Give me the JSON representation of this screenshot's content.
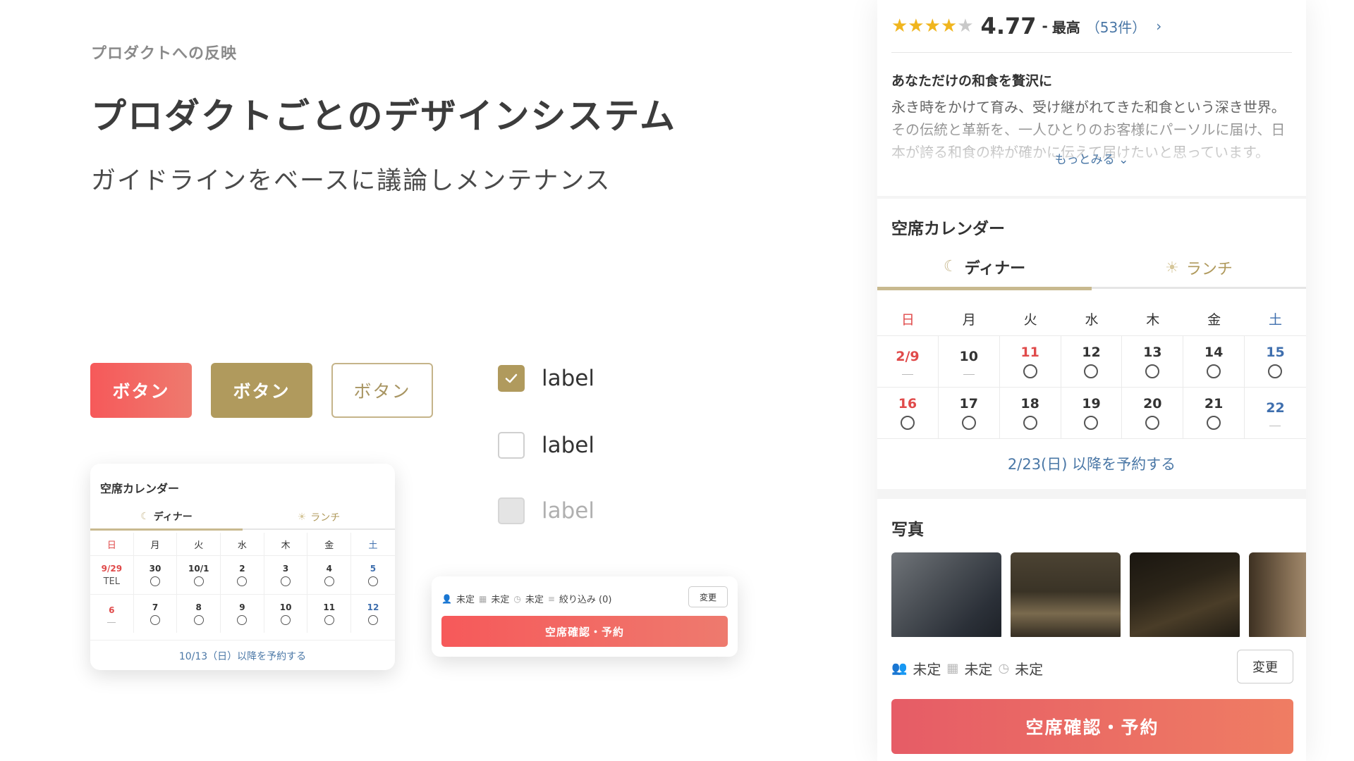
{
  "header": {
    "eyebrow": "プロダクトへの反映",
    "title": "プロダクトごとのデザインシステム",
    "subtitle": "ガイドラインをベースに議論しメンテナンス"
  },
  "buttons": {
    "primary": "ボタン",
    "secondary": "ボタン",
    "outline": "ボタン"
  },
  "checkboxes": [
    {
      "label": "label",
      "state": "checked"
    },
    {
      "label": "label",
      "state": "unchecked"
    },
    {
      "label": "label",
      "state": "disabled"
    }
  ],
  "mini_calendar": {
    "title": "空席カレンダー",
    "tab_dinner": "ディナー",
    "tab_lunch": "ランチ",
    "weekdays": [
      "日",
      "月",
      "火",
      "水",
      "木",
      "金",
      "土"
    ],
    "row1": [
      "9/29",
      "30",
      "10/1",
      "2",
      "3",
      "4",
      "5"
    ],
    "row1_status": [
      "TEL",
      "○",
      "○",
      "○",
      "○",
      "○",
      "○"
    ],
    "row2": [
      "6",
      "7",
      "8",
      "9",
      "10",
      "11",
      "12"
    ],
    "row2_status": [
      "—",
      "○",
      "○",
      "○",
      "○",
      "○",
      "○"
    ],
    "footer": "10/13（日）以降を予約する"
  },
  "mini_bar": {
    "people": "未定",
    "date": "未定",
    "time": "未定",
    "filter": "絞り込み (0)",
    "change": "変更",
    "reserve": "空席確認・予約"
  },
  "phone": {
    "rating": {
      "stars": "★★★★",
      "half_star": "★",
      "value": "4.77",
      "separator": "-",
      "word": "最高",
      "count": "（53件）",
      "chevron": "›"
    },
    "description": {
      "title": "あなただけの和食を贅沢に",
      "body": "永き時をかけて育み、受け継がれてきた和食という深き世界。その伝統と革新を、一人ひとりのお客様にパーソルに届け、日本が誇る和食の粋が確かに伝えて届けたいと思っています。",
      "more": "もっとみる ⌄"
    },
    "calendar": {
      "title": "空席カレンダー",
      "tab_dinner": "ディナー",
      "tab_lunch": "ランチ",
      "weekdays": [
        "日",
        "月",
        "火",
        "水",
        "木",
        "金",
        "土"
      ],
      "row1": [
        "2/9",
        "10",
        "11",
        "12",
        "13",
        "14",
        "15"
      ],
      "row1_status": [
        "—",
        "—",
        "○",
        "○",
        "○",
        "○",
        "○"
      ],
      "row2": [
        "16",
        "17",
        "18",
        "19",
        "20",
        "21",
        "22"
      ],
      "row2_status": [
        "○",
        "○",
        "○",
        "○",
        "○",
        "○",
        "—"
      ],
      "footer": "2/23(日) 以降を予約する"
    },
    "photos_title": "写真",
    "bottom": {
      "people": "未定",
      "date": "未定",
      "time": "未定",
      "change": "変更",
      "reserve": "空席確認・予約"
    }
  },
  "colors": {
    "primary_red": "#f6595a",
    "gold": "#b09a5d",
    "link_blue": "#4a77a6",
    "sunday_red": "#e04a4a",
    "saturday_blue": "#3f6fae",
    "star_yellow": "#f0b51e"
  }
}
